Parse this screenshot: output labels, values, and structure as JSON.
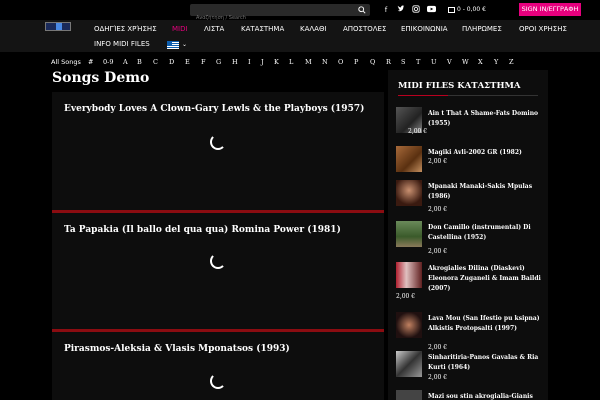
{
  "topbar": {
    "search_placeholder": "Αναζήτηση / Search",
    "social": [
      "f",
      "t",
      "ig",
      "yt"
    ],
    "cart": "0 - 0,00 €",
    "signin": "SIGN IN/ΕΓΓΡΑΦΗ"
  },
  "nav": {
    "items": [
      "ΟΔΗΓΊΕΣ ΧΡΉΣΗΣ",
      "MIDI",
      "ΛΙΣΤΑ",
      "ΚΑΤΑΣΤΗΜΑ",
      "ΚΑΛΑΘΙ",
      "ΑΠΟΣΤΟΛΕΣ",
      "ΕΠΙΚΟΙΝΩΝΙΑ",
      "ΠΛΗΡΩΜΕΣ",
      "ΟΡΟΙ ΧΡΗΣΗΣ"
    ],
    "info": "INFO MIDI FILES",
    "active": "MIDI"
  },
  "alphabet": [
    "All Songs",
    "#",
    "0-9",
    "A",
    "B",
    "C",
    "D",
    "E",
    "F",
    "G",
    "H",
    "I",
    "J",
    "K",
    "L",
    "M",
    "N",
    "O",
    "P",
    "Q",
    "R",
    "S",
    "T",
    "U",
    "V",
    "W",
    "X",
    "Y",
    "Z"
  ],
  "main": {
    "title": "Songs Demo",
    "songs": [
      "Everybody Loves A Clown-Gary Lewls & the Playboys (1957)",
      "Ta Papakia (Il ballo del qua qua) Romina Power (1981)",
      "Pirasmos-Aleksia & Vlasis Mponatsos (1993)"
    ]
  },
  "sidebar": {
    "title": "MIDI FILES ΚΑΤΑΣΤΗΜΑ",
    "products": [
      {
        "name": "Ain t That A Shame-Fats Domino (1955)",
        "price": "2,00 €"
      },
      {
        "name": "Magiki Avli-2002 GR (1982)",
        "price": "2,00 €"
      },
      {
        "name": "Mpanaki Manaki-Sakis Mpulas (1986)",
        "price": "2,00 €"
      },
      {
        "name": "Don Camillo (instrumental) Di Castellina (1952)",
        "price": "2,00 €"
      },
      {
        "name": "Akrogialies Dilina (Diaskevi) Eleonora Zuganeli & Imam Baildi (2007)",
        "price": "2,00 €"
      },
      {
        "name": "Lava Mou (San Ifestio pu ksipna) Alkistis Protopsalti (1997)",
        "price": "2,00 €"
      },
      {
        "name": "Sinharitiria-Panos Gavalas & Ria Kurti (1964)",
        "price": "2,00 €"
      },
      {
        "name": "Mazi sou stin akrogialia-Gianis",
        "price": ""
      }
    ]
  }
}
